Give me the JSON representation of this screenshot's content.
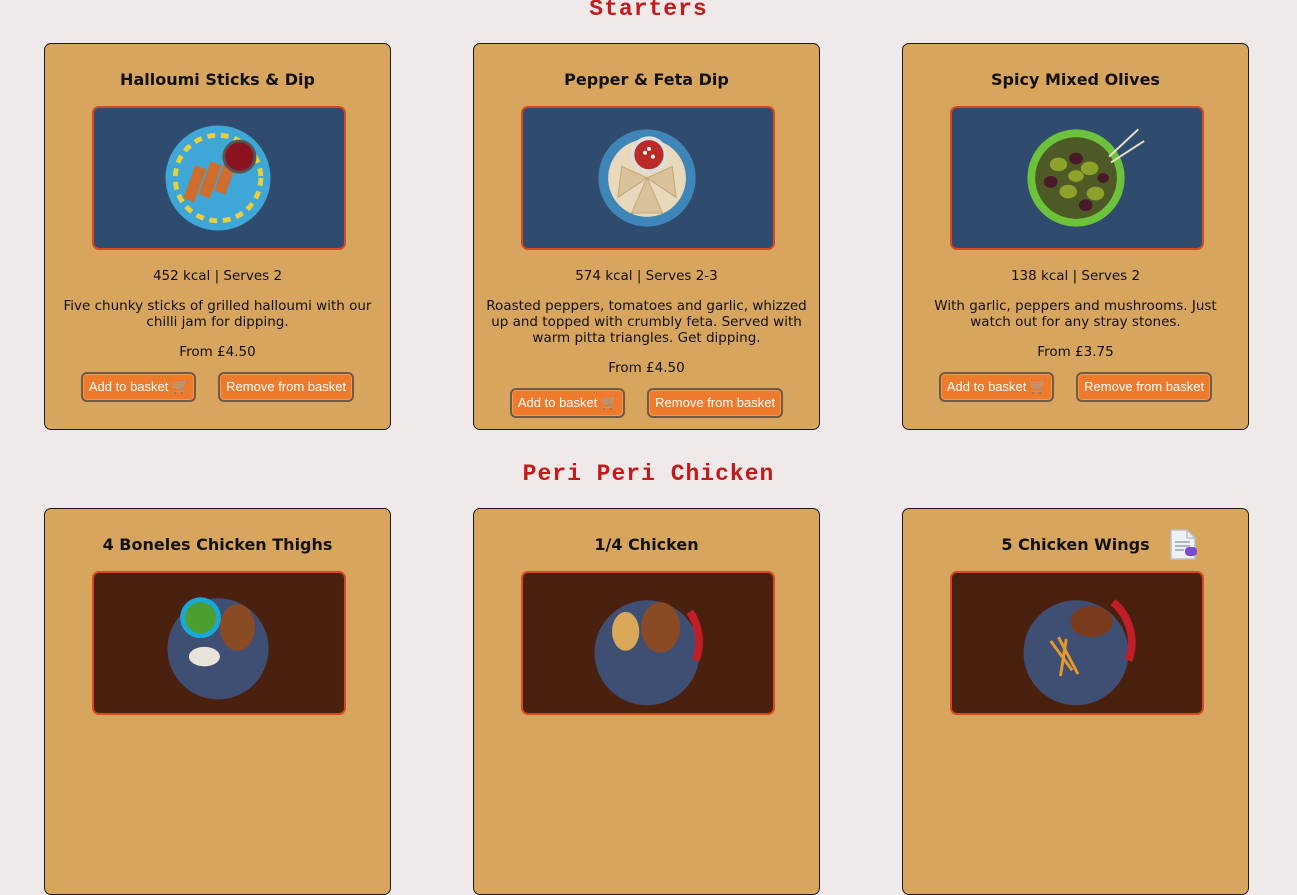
{
  "sections": [
    {
      "title": "Starters",
      "items": [
        {
          "name": "Halloumi Sticks & Dip",
          "meta": "452 kcal | Serves 2",
          "desc": "Five chunky sticks of grilled halloumi with our chilli jam for dipping.",
          "price": "From £4.50",
          "add": "Add to basket 🛒",
          "remove": "Remove from basket",
          "image_icon": "halloumi-plate-icon"
        },
        {
          "name": "Pepper & Feta Dip",
          "meta": "574 kcal | Serves 2-3",
          "desc": "Roasted peppers, tomatoes and garlic, whizzed up and topped with crumbly feta. Served with warm pitta triangles. Get dipping.",
          "price": "From £4.50",
          "add": "Add to basket 🛒",
          "remove": "Remove from basket",
          "image_icon": "dip-plate-icon"
        },
        {
          "name": "Spicy Mixed Olives",
          "meta": "138 kcal | Serves 2",
          "desc": "With garlic, peppers and mushrooms. Just watch out for any stray stones.",
          "price": "From £3.75",
          "add": "Add to basket 🛒",
          "remove": "Remove from basket",
          "image_icon": "olives-bowl-icon"
        }
      ]
    },
    {
      "title": "Peri Peri Chicken",
      "items": [
        {
          "name": "4 Boneles Chicken Thighs",
          "image_icon": "chicken-thighs-plate-icon"
        },
        {
          "name": "1/4 Chicken",
          "image_icon": "quarter-chicken-plate-icon"
        },
        {
          "name": "5 Chicken Wings",
          "image_icon": "chicken-wings-plate-icon"
        }
      ]
    }
  ],
  "floating_icon": "document-icon"
}
